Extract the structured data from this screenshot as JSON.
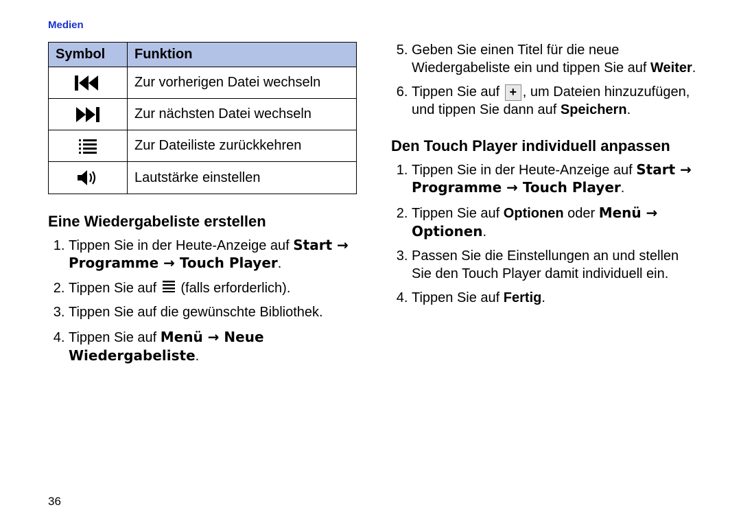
{
  "header": {
    "section": "Medien"
  },
  "page_number": "36",
  "table": {
    "head": {
      "symbol": "Symbol",
      "function": "Funktion"
    },
    "rows": [
      {
        "icon": "prev-track-icon",
        "text": "Zur vorherigen Datei wechseln"
      },
      {
        "icon": "next-track-icon",
        "text": "Zur nächsten Datei wechseln"
      },
      {
        "icon": "file-list-icon",
        "text": "Zur Dateiliste zurückkehren"
      },
      {
        "icon": "volume-icon",
        "text": "Lautstärke einstellen"
      }
    ]
  },
  "left": {
    "heading": "Eine Wiedergabeliste erstellen",
    "steps": {
      "s1a": "Tippen Sie in der Heute-Anzeige auf ",
      "s1b": "Start → Programme → Touch Player",
      "s1c": ".",
      "s2a": "Tippen Sie auf ",
      "s2b": " (falls erforderlich).",
      "s3": "Tippen Sie auf die gewünschte Bibliothek.",
      "s4a": "Tippen Sie auf ",
      "s4b": "Menü → Neue Wiedergabeliste",
      "s4c": "."
    }
  },
  "right": {
    "steps_cont": {
      "s5a": "Geben Sie einen Titel für die neue Wiedergabeliste ein und tippen Sie auf ",
      "s5b": "Weiter",
      "s5c": ".",
      "s6a": "Tippen Sie auf ",
      "s6b": ", um Dateien hinzuzufügen, und tippen Sie dann auf ",
      "s6c": "Speichern",
      "s6d": "."
    },
    "heading": "Den Touch Player individuell anpassen",
    "steps": {
      "s1a": "Tippen Sie in der Heute-Anzeige auf ",
      "s1b": "Start → Programme → Touch Player",
      "s1c": ".",
      "s2a": "Tippen Sie auf ",
      "s2b": "Optionen",
      "s2c": " oder ",
      "s2d": "Menü → Optionen",
      "s2e": ".",
      "s3": "Passen Sie die Einstellungen an und stellen Sie den Touch Player damit individuell ein.",
      "s4a": "Tippen Sie auf ",
      "s4b": "Fertig",
      "s4c": "."
    }
  },
  "icons": {
    "plus": "+"
  }
}
